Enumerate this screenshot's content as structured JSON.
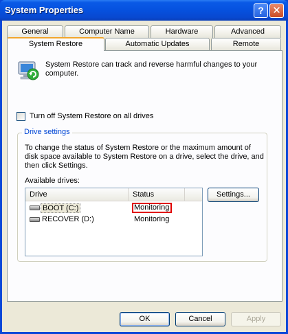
{
  "window": {
    "title": "System Properties",
    "help_glyph": "?",
    "close_glyph": "✕"
  },
  "tabs_back": [
    "General",
    "Computer Name",
    "Hardware",
    "Advanced"
  ],
  "tabs_front": [
    "System Restore",
    "Automatic Updates",
    "Remote"
  ],
  "active_tab": "System Restore",
  "panel": {
    "intro": "System Restore can track and reverse harmful changes to your computer.",
    "turn_off_label": "Turn off System Restore on all drives",
    "turn_off_checked": false,
    "group_title": "Drive settings",
    "group_desc": "To change the status of System Restore or the maximum amount of disk space available to System Restore on a drive, select the drive, and then click Settings.",
    "available_label": "Available drives:",
    "columns": [
      "Drive",
      "Status"
    ],
    "drives": [
      {
        "name": "BOOT (C:)",
        "status": "Monitoring"
      },
      {
        "name": "RECOVER (D:)",
        "status": "Monitoring"
      }
    ],
    "settings_label": "Settings..."
  },
  "buttons": {
    "ok": "OK",
    "cancel": "Cancel",
    "apply": "Apply"
  },
  "colors": {
    "title_bar": "#0a5ae6",
    "dialog_bg": "#ece9d8",
    "highlight": "#e00000",
    "group_title": "#0046d5"
  }
}
